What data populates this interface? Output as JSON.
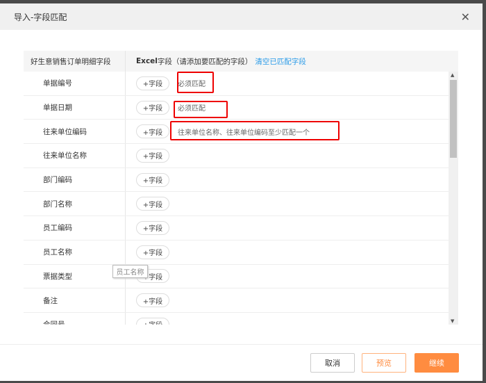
{
  "dialog": {
    "title": "导入-字段匹配",
    "close_icon": "close-icon"
  },
  "table": {
    "col1_header": "好生意销售订单明细字段",
    "col2_header_bold": "Excel",
    "col2_header_rest": "字段（请添加要匹配的字段）",
    "clear_link": "清空已匹配字段",
    "add_label": "+字段",
    "rows": [
      {
        "label": "单据编号",
        "hint": "必须匹配"
      },
      {
        "label": "单据日期",
        "hint": "必须匹配"
      },
      {
        "label": "往来单位编码",
        "hint": "往来单位名称、往来单位编码至少匹配一个"
      },
      {
        "label": "往来单位名称"
      },
      {
        "label": "部门编码"
      },
      {
        "label": "部门名称"
      },
      {
        "label": "员工编码"
      },
      {
        "label": "员工名称"
      },
      {
        "label": "票据类型"
      },
      {
        "label": "备注"
      },
      {
        "label": "合同号"
      }
    ]
  },
  "tooltip": "员工名称",
  "footer": {
    "cancel": "取消",
    "preview": "预览",
    "continue": "继续"
  },
  "colors": {
    "accent": "#ff8c40",
    "link": "#2a9be8",
    "highlight": "#e00000"
  }
}
